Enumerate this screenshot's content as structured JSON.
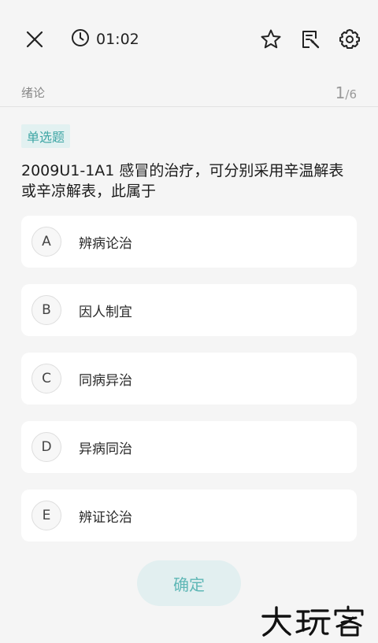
{
  "header": {
    "timer": "01:02",
    "close_icon": "close-icon",
    "clock_icon": "clock-icon",
    "star_icon": "star-icon",
    "edit_icon": "edit-note-icon",
    "settings_icon": "gear-icon"
  },
  "section": {
    "label": "绪论",
    "current": "1",
    "total": "/6"
  },
  "question": {
    "type": "单选题",
    "text": "2009U1-1A1 感冒的治疗，可分别采用辛温解表或辛凉解表，此属于",
    "options": [
      {
        "letter": "A",
        "text": "辨病论治"
      },
      {
        "letter": "B",
        "text": "因人制宜"
      },
      {
        "letter": "C",
        "text": "同病异治"
      },
      {
        "letter": "D",
        "text": "异病同治"
      },
      {
        "letter": "E",
        "text": "辨证论治"
      }
    ]
  },
  "confirm_label": "确定",
  "watermark": "大玩客",
  "colors": {
    "accent": "#3fa6a5",
    "badge_bg": "#e2f1f1",
    "page_bg": "#f5f5f5"
  }
}
